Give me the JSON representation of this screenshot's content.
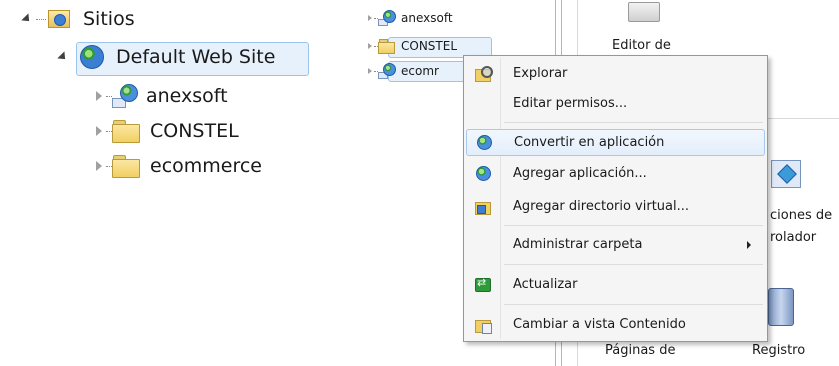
{
  "left_tree": {
    "root": {
      "label": "Sitios",
      "icon": "sites-icon"
    },
    "site": {
      "label": "Default Web Site",
      "icon": "globe-icon"
    },
    "children": [
      {
        "label": "anexsoft",
        "icon": "application-icon"
      },
      {
        "label": "CONSTEL",
        "icon": "folder-icon"
      },
      {
        "label": "ecommerce",
        "icon": "folder-icon"
      }
    ]
  },
  "mini_tree": {
    "items": [
      {
        "label": "anexsoft",
        "icon": "application-icon"
      },
      {
        "label": "CONSTEL",
        "icon": "folder-icon"
      },
      {
        "label": "ecomr",
        "icon": "application-icon"
      }
    ]
  },
  "background_panel": {
    "editor_label": "Editor de",
    "controller_label_1": "ciones de",
    "controller_label_2": "rolador",
    "pages_label": "Páginas de",
    "log_label": "Registro"
  },
  "context_menu": {
    "items": [
      {
        "label": "Explorar",
        "icon": "explore-icon"
      },
      {
        "label": "Editar permisos...",
        "icon": ""
      },
      {
        "label": "Convertir en aplicación",
        "icon": "globe-app-icon",
        "highlighted": true
      },
      {
        "label": "Agregar aplicación...",
        "icon": "globe-app-icon"
      },
      {
        "label": "Agregar directorio virtual...",
        "icon": "virtual-directory-icon"
      },
      {
        "label": "Administrar carpeta",
        "icon": "",
        "has_submenu": true
      },
      {
        "label": "Actualizar",
        "icon": "refresh-icon"
      },
      {
        "label": "Cambiar a vista Contenido",
        "icon": "content-view-icon"
      }
    ]
  },
  "colors": {
    "selection_bg": "#e7f1fc",
    "selection_border": "#9cc3ec",
    "menu_bg": "#f5f5f5",
    "menu_highlight_border": "#a8c8ed"
  }
}
